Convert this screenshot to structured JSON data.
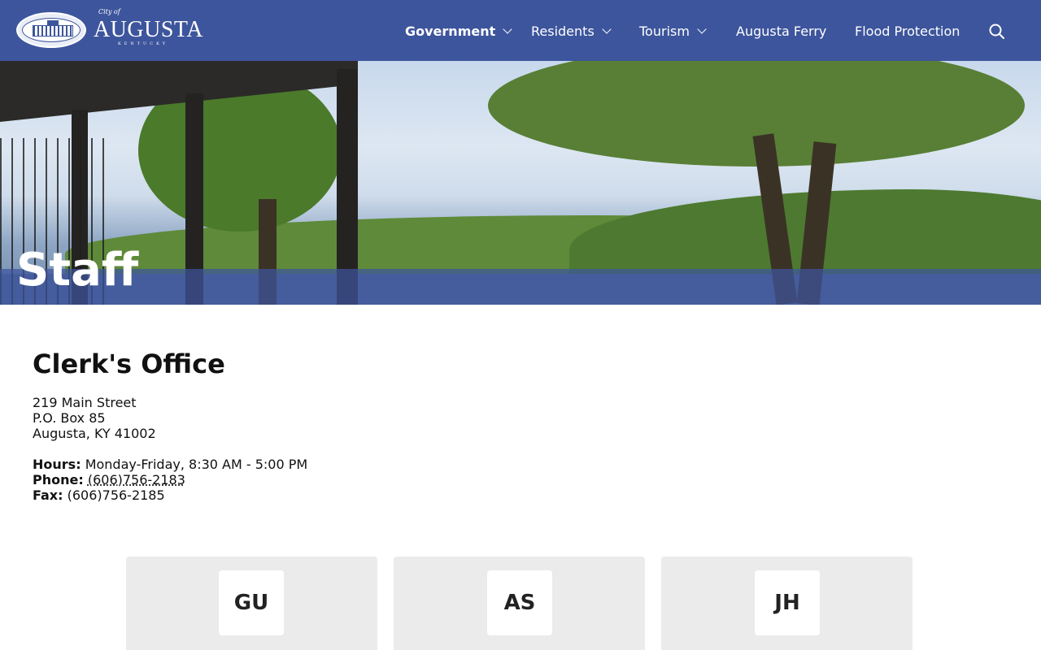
{
  "header": {
    "logo": {
      "top_text": "City of",
      "name": "AUGUSTA",
      "state": "KENTUCKY"
    },
    "nav": [
      {
        "label": "Government",
        "has_dropdown": true,
        "active": true
      },
      {
        "label": "Residents",
        "has_dropdown": true,
        "active": false
      },
      {
        "label": "Tourism",
        "has_dropdown": true,
        "active": false
      },
      {
        "label": "Augusta Ferry",
        "has_dropdown": false,
        "active": false
      },
      {
        "label": "Flood Protection",
        "has_dropdown": false,
        "active": false
      }
    ],
    "search_icon": "search-icon"
  },
  "hero": {
    "title": "Staff"
  },
  "office": {
    "title": "Clerk's Office",
    "address": [
      "219 Main Street",
      "P.O. Box 85",
      "Augusta, KY 41002"
    ],
    "hours_label": "Hours:",
    "hours_value": "Monday-Friday, 8:30 AM - 5:00 PM",
    "phone_label": "Phone:",
    "phone_value": "(606)756-2183",
    "fax_label": "Fax:",
    "fax_value": "(606)756-2185"
  },
  "staff_cards": [
    {
      "initials": "GU"
    },
    {
      "initials": "AS"
    },
    {
      "initials": "JH"
    }
  ],
  "colors": {
    "brand": "#3d559c",
    "card_bg": "#ebebeb",
    "text": "#111111"
  }
}
